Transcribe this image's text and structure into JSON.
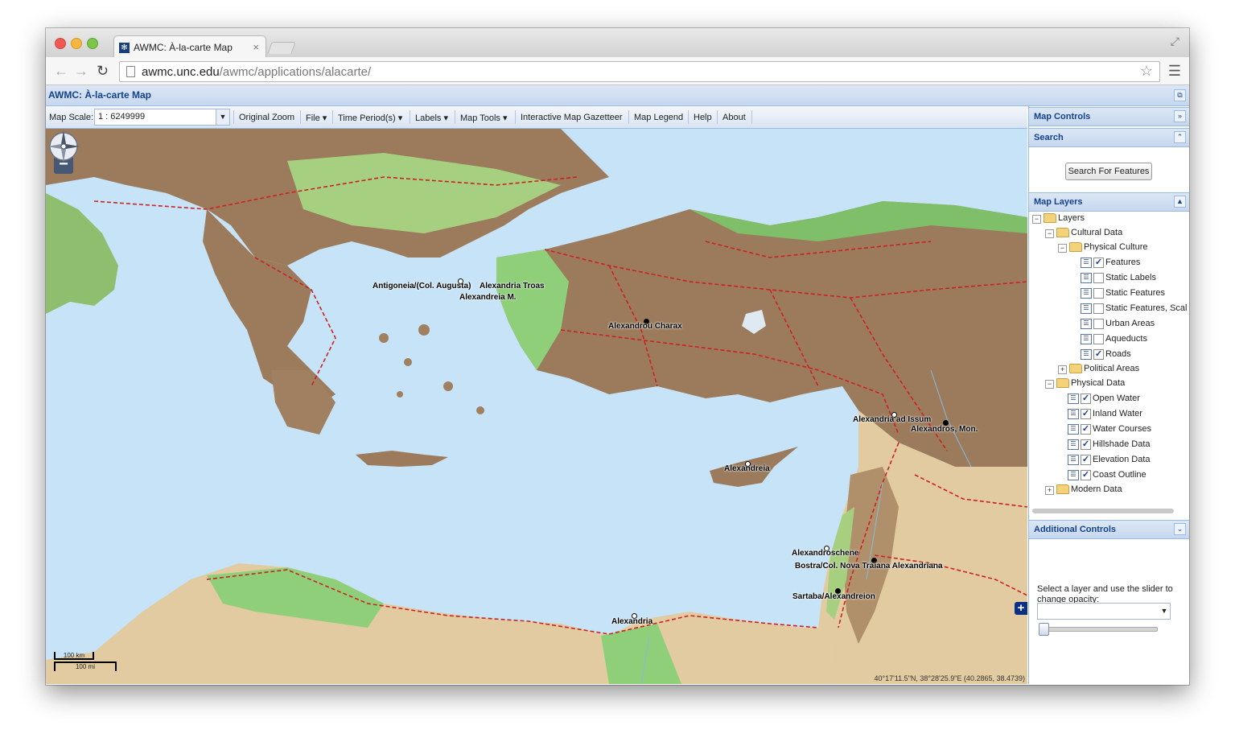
{
  "browser": {
    "tab_title": "AWMC: À-la-carte Map",
    "tab_close": "×",
    "url_host": "awmc.unc.edu",
    "url_path": "/awmc/applications/alacarte/"
  },
  "app": {
    "title": "AWMC: À-la-carte Map"
  },
  "map_toolbar": {
    "scale_label": "Map Scale:",
    "scale_value": "1 : 6249999",
    "buttons": [
      "Original Zoom",
      "File ▾",
      "Time Period(s) ▾",
      "Labels ▾",
      "Map Tools ▾",
      "Interactive Map Gazetteer",
      "Map Legend",
      "Help",
      "About"
    ]
  },
  "map": {
    "zoom_in": "+",
    "zoom_out": "−",
    "places": [
      "Antigoneia/(Col. Augusta)",
      "Alexandria Troas",
      "Alexandreia M.",
      "Alexandrou Charax",
      "Alexandria ad Issum",
      "Alexandros, Mon.",
      "Alexandreia",
      "Alexandroschene",
      "Bostra/Col. Nova Traiana Alexandriana",
      "Sartaba/Alexandreion",
      "Alexandria"
    ],
    "scale_km": "100 km",
    "scale_mi": "100 mi",
    "coordinates": "40°17'11.5\"N, 38°28'25.9\"E (40.2865, 38.4739)",
    "overview_toggle": "+",
    "colors": {
      "sea": "#c7e3f7",
      "lowland": "#8fcf7a",
      "highland": "#9b7b5c",
      "desert": "#e2cba0",
      "roads": "#cc2222"
    }
  },
  "panel": {
    "map_controls": "Map Controls",
    "search": "Search",
    "search_button": "Search For Features",
    "map_layers": "Map Layers",
    "additional_controls": "Additional Controls",
    "opacity_text": "Select a layer and use the slider to change opacity:",
    "opacity_value": 0
  },
  "layers": {
    "root": "Layers",
    "cultural": "Cultural Data",
    "physical_culture": "Physical Culture",
    "pc_items": [
      {
        "label": "Features",
        "checked": true
      },
      {
        "label": "Static Labels",
        "checked": false
      },
      {
        "label": "Static Features",
        "checked": false
      },
      {
        "label": "Static Features, Scal",
        "checked": false
      },
      {
        "label": "Urban Areas",
        "checked": false
      },
      {
        "label": "Aqueducts",
        "checked": false
      },
      {
        "label": "Roads",
        "checked": true
      }
    ],
    "political": "Political Areas",
    "physical": "Physical Data",
    "phys_items": [
      {
        "label": "Open Water",
        "checked": true
      },
      {
        "label": "Inland Water",
        "checked": true
      },
      {
        "label": "Water Courses",
        "checked": true
      },
      {
        "label": "Hillshade Data",
        "checked": true
      },
      {
        "label": "Elevation Data",
        "checked": true
      },
      {
        "label": "Coast Outline",
        "checked": true
      }
    ],
    "modern": "Modern Data"
  }
}
